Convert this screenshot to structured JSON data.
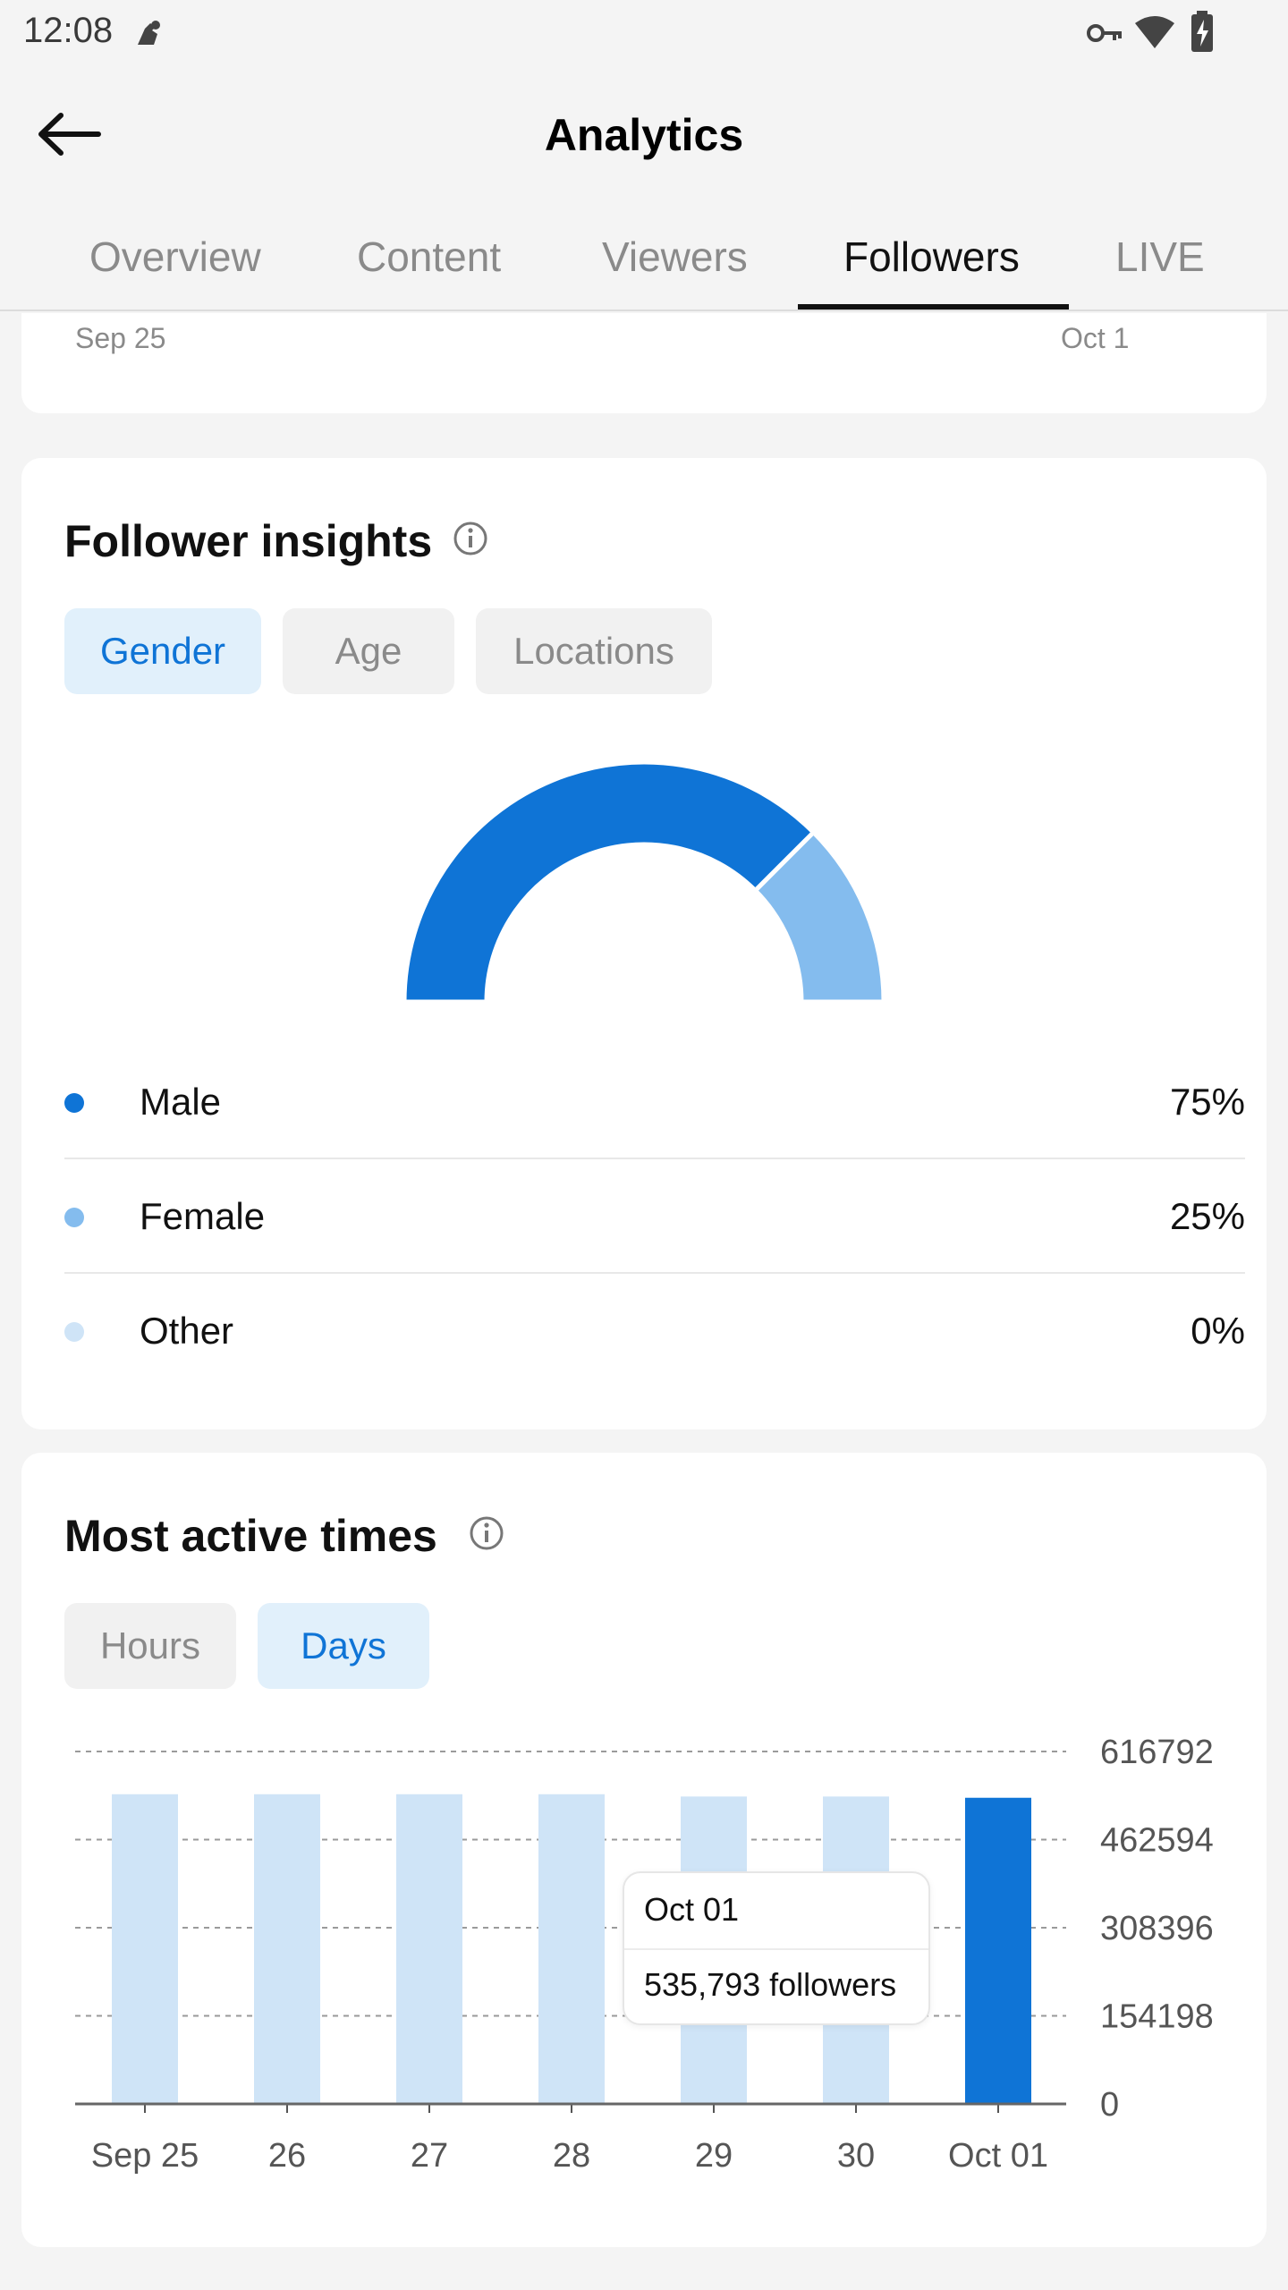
{
  "status_bar": {
    "time": "12:08",
    "icons": [
      "notification-icon",
      "vpn-key-icon",
      "wifi-icon",
      "battery-charging-icon"
    ]
  },
  "app_bar": {
    "title": "Analytics",
    "back_icon": "arrow-left-icon"
  },
  "tabs": [
    {
      "label": "Overview",
      "active": false
    },
    {
      "label": "Content",
      "active": false
    },
    {
      "label": "Viewers",
      "active": false
    },
    {
      "label": "Followers",
      "active": true
    },
    {
      "label": "LIVE",
      "active": false
    }
  ],
  "previous_card": {
    "start_date": "Sep 25",
    "end_date": "Oct 1"
  },
  "follower_insights": {
    "title": "Follower insights",
    "info_icon": "info-icon",
    "filters": [
      {
        "label": "Gender",
        "active": true
      },
      {
        "label": "Age",
        "active": false
      },
      {
        "label": "Locations",
        "active": false
      }
    ],
    "chart_data": {
      "type": "pie",
      "variant": "semi-donut",
      "labels": [
        "Male",
        "Female",
        "Other"
      ],
      "values": [
        75,
        25,
        0
      ],
      "colors": [
        "#0f74d6",
        "#84bcee",
        "#cfe4f7"
      ]
    },
    "legend": [
      {
        "label": "Male",
        "value": "75%",
        "color": "#0f74d6"
      },
      {
        "label": "Female",
        "value": "25%",
        "color": "#84bcee"
      },
      {
        "label": "Other",
        "value": "0%",
        "color": "#cfe4f7"
      }
    ]
  },
  "most_active_times": {
    "title": "Most active times",
    "info_icon": "info-icon",
    "filters": [
      {
        "label": "Hours",
        "active": false
      },
      {
        "label": "Days",
        "active": true
      }
    ],
    "chart_data": {
      "type": "bar",
      "categories": [
        "Sep 25",
        "26",
        "27",
        "28",
        "29",
        "30",
        "Oct 01"
      ],
      "values": [
        542000,
        542000,
        542000,
        542000,
        538000,
        538000,
        535793
      ],
      "ylim": [
        0,
        616792
      ],
      "yticks": [
        "616792",
        "462594",
        "308396",
        "154198",
        "0"
      ],
      "highlighted_index": 6,
      "colors": {
        "default": "#cfe4f7",
        "highlight": "#0f74d6"
      },
      "grid": true,
      "y_axis_side": "right"
    },
    "tooltip": {
      "date": "Oct 01",
      "value": "535,793 followers"
    }
  }
}
